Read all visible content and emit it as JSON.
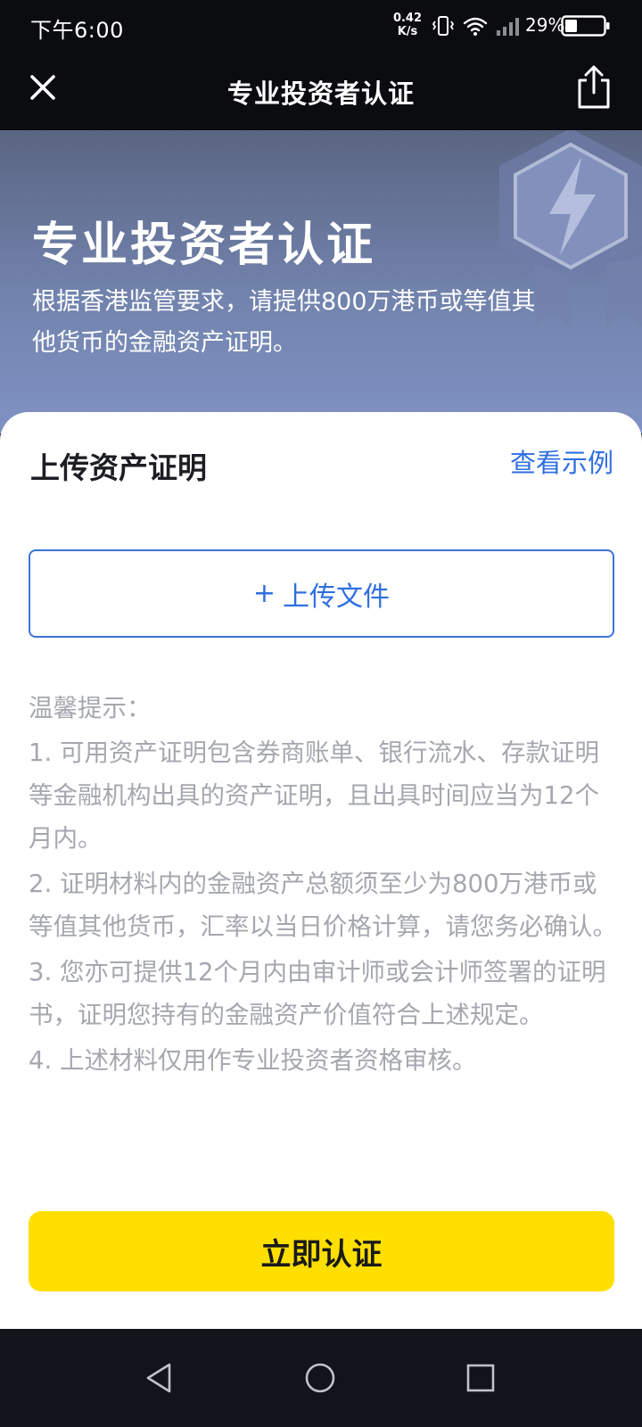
{
  "status_bar": {
    "time": "下午6:00",
    "net_speed_value": "0.42",
    "net_speed_unit": "K/s",
    "battery": "29%"
  },
  "nav": {
    "title": "专业投资者认证",
    "close_icon": "close-icon",
    "share_icon": "share-icon"
  },
  "hero": {
    "title": "专业投资者认证",
    "description": "根据香港监管要求，请提供800万港币或等值其他货币的金融资产证明。"
  },
  "upload_section": {
    "title": "上传资产证明",
    "view_example": "查看示例",
    "upload_plus": "+",
    "upload_label": "上传文件"
  },
  "tips": {
    "heading": "温馨提示：",
    "items": [
      "1. 可用资产证明包含券商账单、银行流水、存款证明等金融机构出具的资产证明，且出具时间应当为12个月内。",
      "2. 证明材料内的金融资产总额须至少为800万港币或等值其他货币，汇率以当日价格计算，请您务必确认。",
      "3. 您亦可提供12个月内由审计师或会计师签署的证明书，证明您持有的金融资产价值符合上述规定。",
      "4. 上述材料仅用作专业投资者资格审核。"
    ]
  },
  "actions": {
    "confirm": "立即认证"
  },
  "colors": {
    "accent_blue": "#2f6fe0",
    "confirm_yellow": "#ffdf00",
    "nav_dark": "#0b0c10"
  }
}
